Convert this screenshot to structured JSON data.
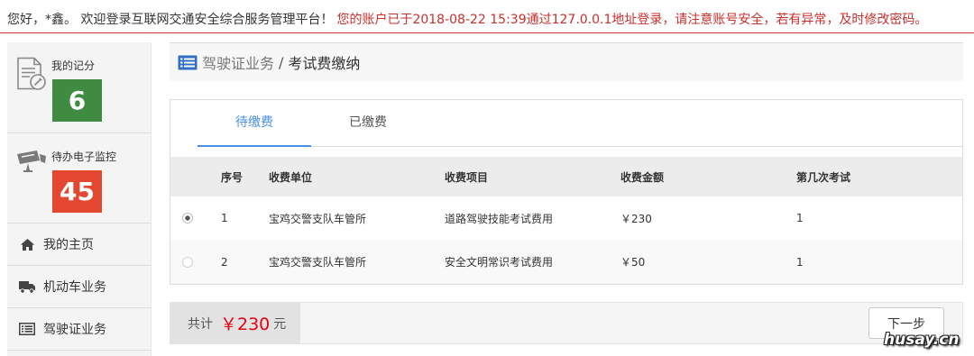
{
  "topbar": {
    "greeting": "您好，*鑫。 欢迎登录互联网交通安全综合服务管理平台！",
    "notice": "您的账户已于2018-08-22 15:39通过127.0.0.1地址登录，请注意账号安全，若有异常，及时修改密码。"
  },
  "sidebar": {
    "score": {
      "label": "我的记分",
      "value": "6",
      "icon": "document-pencil-icon"
    },
    "monitor": {
      "label": "待办电子监控",
      "value": "45",
      "icon": "camera-icon"
    },
    "nav": [
      {
        "label": "我的主页",
        "icon": "home-icon"
      },
      {
        "label": "机动车业务",
        "icon": "truck-icon"
      },
      {
        "label": "驾驶证业务",
        "icon": "list-icon"
      }
    ]
  },
  "breadcrumb": {
    "icon": "list-icon",
    "parent": "驾驶证业务",
    "separator": "/",
    "current": "考试费缴纳"
  },
  "tabs": [
    {
      "label": "待缴费",
      "active": true
    },
    {
      "label": "已缴费",
      "active": false
    }
  ],
  "table": {
    "headers": [
      "序号",
      "收费单位",
      "收费项目",
      "收费金额",
      "第几次考试"
    ],
    "rows": [
      {
        "selected": true,
        "cells": [
          "1",
          "宝鸡交警支队车管所",
          "道路驾驶技能考试费用",
          "￥230",
          "1"
        ]
      },
      {
        "selected": false,
        "cells": [
          "2",
          "宝鸡交警支队车管所",
          "安全文明常识考试费用",
          "￥50",
          "1"
        ]
      }
    ]
  },
  "footer": {
    "total_label": "共计",
    "total_amount": "￥230",
    "total_unit": "元",
    "next_label": "下一步"
  },
  "watermark": "husay.cn",
  "colors": {
    "accent": "#4a90e2",
    "score_green": "#3f8b42",
    "monitor_red": "#e3472f",
    "notice_red": "#c9302c",
    "amount_red": "#e60012",
    "header_rule": "#c9302c",
    "breadcrumb_icon": "#2f6fc4"
  }
}
